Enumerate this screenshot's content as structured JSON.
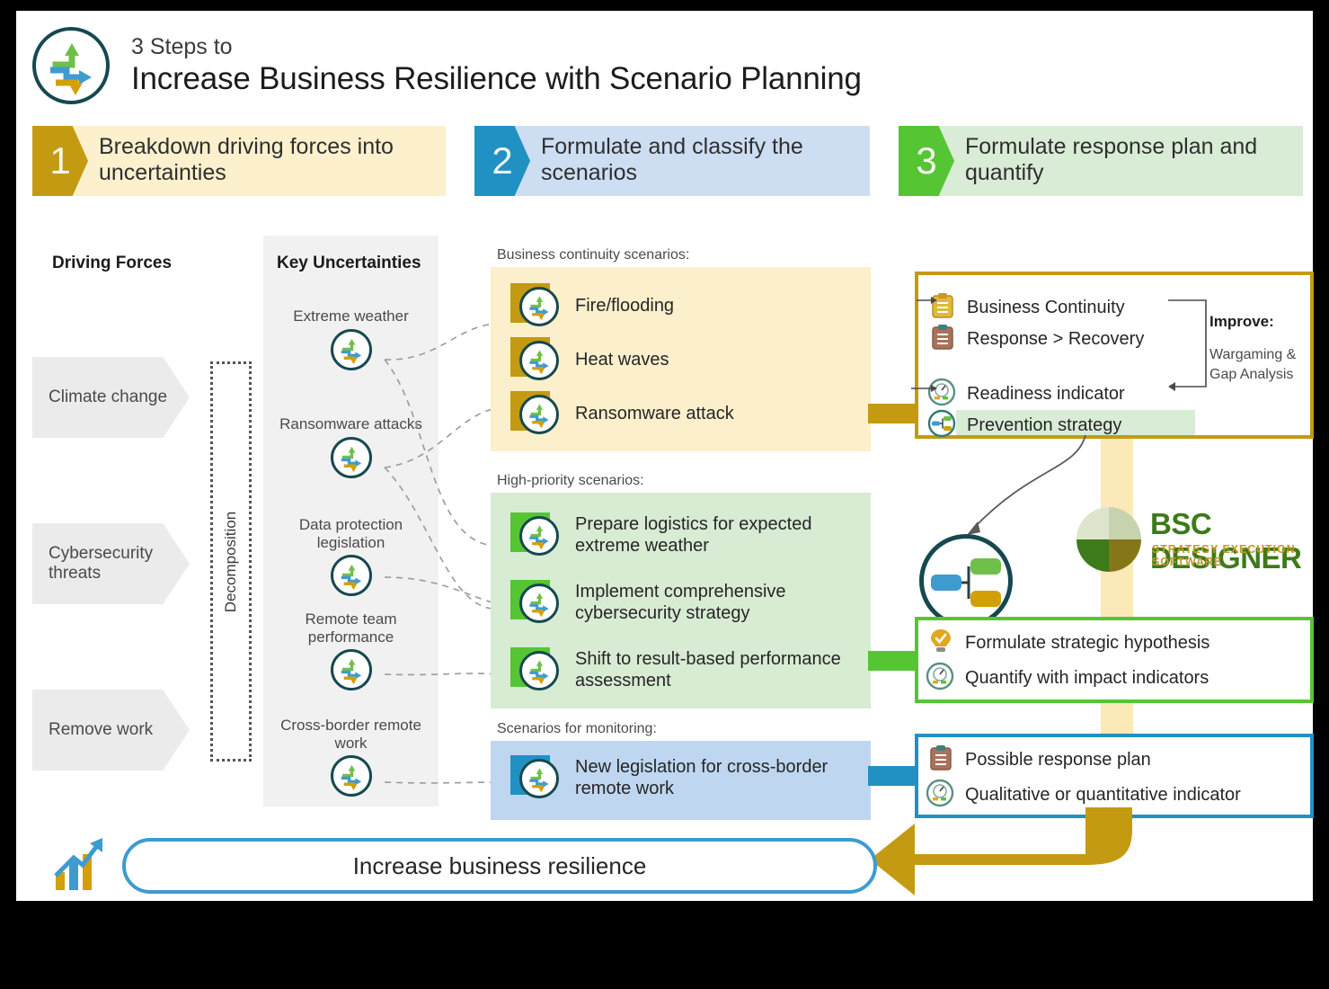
{
  "header": {
    "kicker": "3 Steps to",
    "title": "Increase Business Resilience with Scenario Planning",
    "logo_icon": "three-arrows-circle-icon"
  },
  "steps": [
    {
      "number": "1",
      "label": "Breakdown driving forces into uncertainties",
      "color": "#c49a12",
      "band": "#fcf0cd"
    },
    {
      "number": "2",
      "label": "Formulate and classify the scenarios",
      "color": "#2091c2",
      "band": "#cdddf2"
    },
    {
      "number": "3",
      "label": "Formulate response plan and quantify",
      "color": "#56c534",
      "band": "#d9ecd6"
    }
  ],
  "columns": {
    "driving_forces_heading": "Driving Forces",
    "key_uncertainties_heading": "Key Uncertainties",
    "decomposition_label": "Decomposition"
  },
  "driving_forces": [
    {
      "label": "Climate change"
    },
    {
      "label": "Cybersecurity threats"
    },
    {
      "label": "Remove work"
    }
  ],
  "key_uncertainties": [
    {
      "label": "Extreme weather"
    },
    {
      "label": "Ransomware attacks"
    },
    {
      "label": "Data protection legislation"
    },
    {
      "label": "Remote team performance"
    },
    {
      "label": "Cross-border remote work"
    }
  ],
  "scenario_groups": [
    {
      "caption": "Business continuity scenarios:",
      "accent": "#c49a12",
      "background": "#fcefcc",
      "items": [
        "Fire/flooding",
        "Heat waves",
        "Ransomware attack"
      ]
    },
    {
      "caption": "High-priority scenarios:",
      "accent": "#56c534",
      "background": "#d7ecd3",
      "items": [
        "Prepare logistics for expected extreme weather",
        "Implement comprehensive cybersecurity strategy",
        "Shift to result-based performance assessment"
      ]
    },
    {
      "caption": "Scenarios for monitoring:",
      "accent": "#2091c2",
      "background": "#bfd6f0",
      "items": [
        "New legislation for cross-border remote work"
      ]
    }
  ],
  "response_panels": {
    "gold": {
      "border": "#c49a12",
      "rows": [
        {
          "label": "Business Continuity",
          "icon": "clipboard-gold-icon"
        },
        {
          "label": "Response > Recovery",
          "icon": "clipboard-brown-icon"
        },
        {
          "label": "Readiness indicator",
          "icon": "gauge-icon"
        },
        {
          "label": "Prevention strategy",
          "icon": "strategy-map-icon"
        }
      ],
      "improve_label": "Improve:",
      "improve_body": "Wargaming & Gap Analysis"
    },
    "green": {
      "border": "#56c534",
      "rows": [
        {
          "label": "Formulate strategic hypothesis",
          "icon": "lightbulb-check-icon"
        },
        {
          "label": "Quantify with impact indicators",
          "icon": "gauge-icon"
        }
      ]
    },
    "blue": {
      "border": "#2091c2",
      "rows": [
        {
          "label": "Possible response plan",
          "icon": "clipboard-brown-icon"
        },
        {
          "label": "Qualitative or quantitative indicator",
          "icon": "gauge-icon"
        }
      ]
    }
  },
  "brand": {
    "name": "BSC DESIGNER",
    "tagline": "STRATEGY EXECUTION SOFTWARE",
    "name_color": "#3e7a18",
    "tagline_color": "#c09a2a"
  },
  "footer": {
    "goal_label": "Increase business resilience",
    "goal_border_color": "#3e9bd0",
    "arrow_color": "#c49a12",
    "growth_icon": "growth-chart-icon"
  }
}
